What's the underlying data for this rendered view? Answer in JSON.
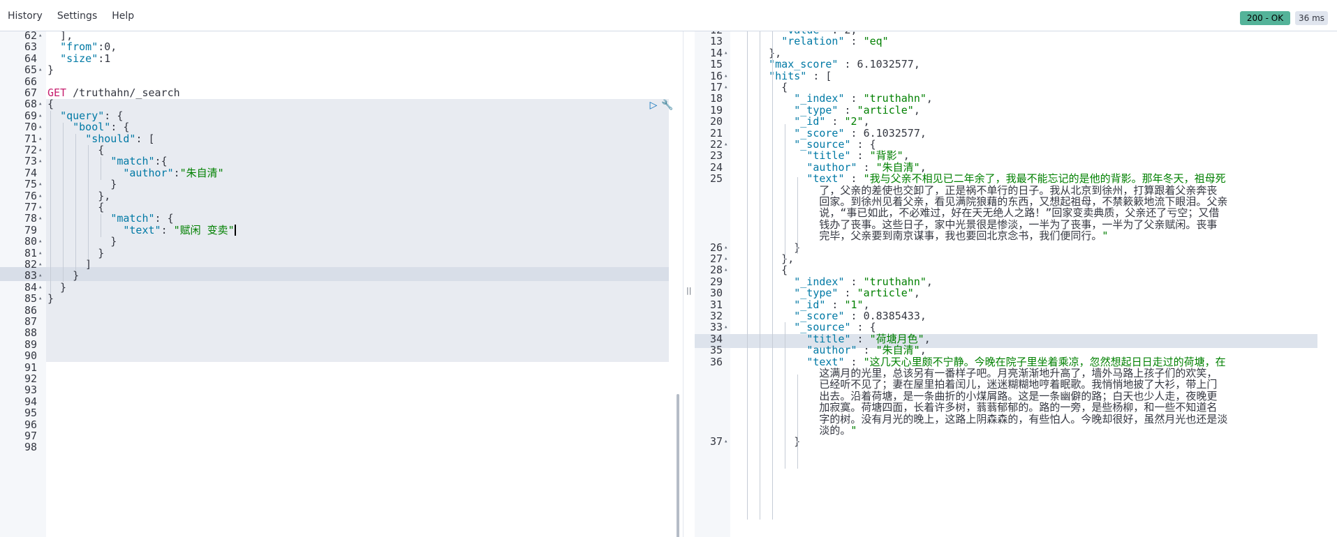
{
  "menu": {
    "history": "History",
    "settings": "Settings",
    "help": "Help"
  },
  "status": {
    "code": "200 - OK",
    "time": "36 ms"
  },
  "icons": {
    "run": "play-icon",
    "wrench": "wrench-icon",
    "divider": "resize-handle-icon"
  },
  "colors": {
    "status_ok": "#54b399",
    "key": "#0079a5",
    "string": "#008000",
    "method": "#c61e6e"
  },
  "request": {
    "lines": [
      {
        "n": "62",
        "fold": true,
        "text": "  ],"
      },
      {
        "n": "63",
        "fold": false,
        "text": "  \"from\":0,"
      },
      {
        "n": "64",
        "fold": false,
        "text": "  \"size\":1"
      },
      {
        "n": "65",
        "fold": true,
        "text": "}"
      },
      {
        "n": "66",
        "fold": false,
        "text": ""
      },
      {
        "n": "67",
        "fold": false,
        "text": "GET /truthahn/_search"
      },
      {
        "n": "68",
        "fold": true,
        "text": "{"
      },
      {
        "n": "69",
        "fold": true,
        "text": "  \"query\": {"
      },
      {
        "n": "70",
        "fold": true,
        "text": "    \"bool\": {"
      },
      {
        "n": "71",
        "fold": true,
        "text": "      \"should\": ["
      },
      {
        "n": "72",
        "fold": true,
        "text": "        {"
      },
      {
        "n": "73",
        "fold": true,
        "text": "          \"match\":{"
      },
      {
        "n": "74",
        "fold": false,
        "text": "            \"author\":\"朱自清\""
      },
      {
        "n": "75",
        "fold": true,
        "text": "          }"
      },
      {
        "n": "76",
        "fold": true,
        "text": "        },"
      },
      {
        "n": "77",
        "fold": true,
        "text": "        {"
      },
      {
        "n": "78",
        "fold": true,
        "text": "          \"match\": {"
      },
      {
        "n": "79",
        "fold": false,
        "text": "            \"text\": \"赋闲 变卖\""
      },
      {
        "n": "80",
        "fold": true,
        "text": "          }"
      },
      {
        "n": "81",
        "fold": true,
        "text": "        }"
      },
      {
        "n": "82",
        "fold": true,
        "text": "      ]"
      },
      {
        "n": "83",
        "fold": true,
        "text": "    }"
      },
      {
        "n": "84",
        "fold": true,
        "text": "  }"
      },
      {
        "n": "85",
        "fold": true,
        "text": "}"
      },
      {
        "n": "86",
        "fold": false,
        "text": ""
      },
      {
        "n": "87",
        "fold": false,
        "text": ""
      },
      {
        "n": "88",
        "fold": false,
        "text": ""
      },
      {
        "n": "89",
        "fold": false,
        "text": ""
      },
      {
        "n": "90",
        "fold": false,
        "text": ""
      },
      {
        "n": "91",
        "fold": false,
        "text": ""
      },
      {
        "n": "92",
        "fold": false,
        "text": ""
      },
      {
        "n": "93",
        "fold": false,
        "text": ""
      },
      {
        "n": "94",
        "fold": false,
        "text": ""
      },
      {
        "n": "95",
        "fold": false,
        "text": ""
      },
      {
        "n": "96",
        "fold": false,
        "text": ""
      },
      {
        "n": "97",
        "fold": false,
        "text": ""
      },
      {
        "n": "98",
        "fold": false,
        "text": ""
      }
    ]
  },
  "response": {
    "lines": [
      {
        "n": "12",
        "fold": false,
        "text": "      \"value\" : 2,"
      },
      {
        "n": "13",
        "fold": false,
        "text": "      \"relation\" : \"eq\""
      },
      {
        "n": "14",
        "fold": true,
        "text": "    },"
      },
      {
        "n": "15",
        "fold": false,
        "text": "    \"max_score\" : 6.1032577,"
      },
      {
        "n": "16",
        "fold": true,
        "text": "    \"hits\" : ["
      },
      {
        "n": "17",
        "fold": true,
        "text": "      {"
      },
      {
        "n": "18",
        "fold": false,
        "text": "        \"_index\" : \"truthahn\","
      },
      {
        "n": "19",
        "fold": false,
        "text": "        \"_type\" : \"article\","
      },
      {
        "n": "20",
        "fold": false,
        "text": "        \"_id\" : \"2\","
      },
      {
        "n": "21",
        "fold": false,
        "text": "        \"_score\" : 6.1032577,"
      },
      {
        "n": "22",
        "fold": true,
        "text": "        \"_source\" : {"
      },
      {
        "n": "23",
        "fold": false,
        "text": "          \"title\" : \"背影\","
      },
      {
        "n": "24",
        "fold": false,
        "text": "          \"author\" : \"朱自清\","
      },
      {
        "n": "25",
        "fold": false,
        "text": "          \"text\" : \"我与父亲不相见已二年余了，我最不能忘记的是他的背影。那年冬天，祖母死"
      },
      {
        "n": "",
        "fold": false,
        "text": "            了，父亲的差使也交卸了，正是祸不单行的日子。我从北京到徐州，打算跟着父亲奔丧"
      },
      {
        "n": "",
        "fold": false,
        "text": "            回家。到徐州见着父亲，看见满院狼藉的东西，又想起祖母，不禁簌簌地流下眼泪。父亲"
      },
      {
        "n": "",
        "fold": false,
        "text": "            说，“事已如此，不必难过，好在天无绝人之路！”回家变卖典质，父亲还了亏空；又借"
      },
      {
        "n": "",
        "fold": false,
        "text": "            钱办了丧事。这些日子，家中光景很是惨淡，一半为了丧事，一半为了父亲赋闲。丧事"
      },
      {
        "n": "",
        "fold": false,
        "text": "            完毕，父亲要到南京谋事，我也要回北京念书，我们便同行。\""
      },
      {
        "n": "26",
        "fold": true,
        "text": "        }"
      },
      {
        "n": "27",
        "fold": true,
        "text": "      },"
      },
      {
        "n": "28",
        "fold": true,
        "text": "      {"
      },
      {
        "n": "29",
        "fold": false,
        "text": "        \"_index\" : \"truthahn\","
      },
      {
        "n": "30",
        "fold": false,
        "text": "        \"_type\" : \"article\","
      },
      {
        "n": "31",
        "fold": false,
        "text": "        \"_id\" : \"1\","
      },
      {
        "n": "32",
        "fold": false,
        "text": "        \"_score\" : 0.8385433,"
      },
      {
        "n": "33",
        "fold": true,
        "text": "        \"_source\" : {"
      },
      {
        "n": "34",
        "fold": false,
        "text": "          \"title\" : \"荷塘月色\","
      },
      {
        "n": "35",
        "fold": false,
        "text": "          \"author\" : \"朱自清\","
      },
      {
        "n": "36",
        "fold": false,
        "text": "          \"text\" : \"这几天心里颇不宁静。今晚在院子里坐着乘凉，忽然想起日日走过的荷塘，在"
      },
      {
        "n": "",
        "fold": false,
        "text": "            这满月的光里，总该另有一番样子吧。月亮渐渐地升高了，墙外马路上孩子们的欢笑，"
      },
      {
        "n": "",
        "fold": false,
        "text": "            已经听不见了；妻在屋里拍着闰儿，迷迷糊糊地哼着眠歌。我悄悄地披了大衫，带上门"
      },
      {
        "n": "",
        "fold": false,
        "text": "            出去。沿着荷塘，是一条曲折的小煤屑路。这是一条幽僻的路；白天也少人走，夜晚更"
      },
      {
        "n": "",
        "fold": false,
        "text": "            加寂寞。荷塘四面，长着许多树，蓊蓊郁郁的。路的一旁，是些杨柳，和一些不知道名"
      },
      {
        "n": "",
        "fold": false,
        "text": "            字的树。没有月光的晚上，这路上阴森森的，有些怕人。今晚却很好，虽然月光也还是淡"
      },
      {
        "n": "",
        "fold": false,
        "text": "            淡的。\""
      },
      {
        "n": "37",
        "fold": true,
        "text": "        }"
      }
    ]
  }
}
